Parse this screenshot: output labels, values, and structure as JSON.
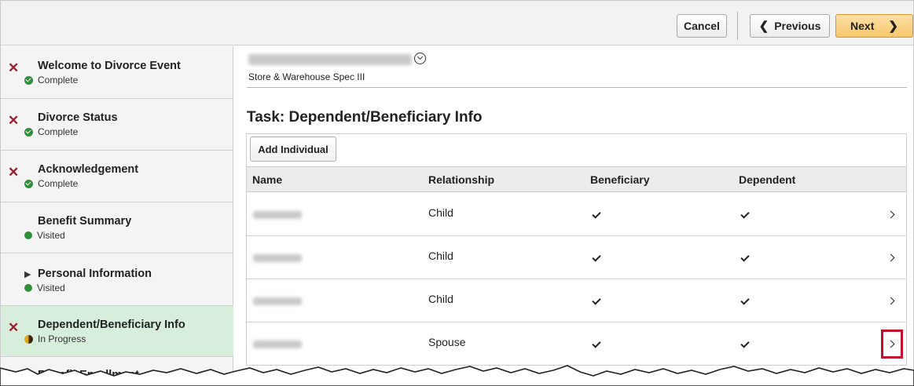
{
  "toolbar": {
    "cancel_label": "Cancel",
    "previous_label": "Previous",
    "next_label": "Next",
    "previous_icon": "chevron-left-icon",
    "next_icon": "chevron-right-icon"
  },
  "sidebar": {
    "items": [
      {
        "label": "Welcome to Divorce Event",
        "status": "Complete",
        "required": true,
        "status_icon": "check-circle-icon"
      },
      {
        "label": "Divorce Status",
        "status": "Complete",
        "required": true,
        "status_icon": "check-circle-icon"
      },
      {
        "label": "Acknowledgement",
        "status": "Complete",
        "required": true,
        "status_icon": "check-circle-icon"
      },
      {
        "label": "Benefit Summary",
        "status": "Visited",
        "required": false,
        "status_icon": "green-dot-icon"
      },
      {
        "label": "Personal Information",
        "status": "Visited",
        "required": false,
        "status_icon": "green-dot-icon",
        "expandable": true
      },
      {
        "label": "Dependent/Beneficiary Info",
        "status": "In Progress",
        "required": true,
        "status_icon": "half-circle-icon",
        "active": true
      },
      {
        "label": "Benefit Enrollment"
      }
    ]
  },
  "employee": {
    "job_title": "Store & Warehouse Spec III",
    "expand_icon": "chevron-down-circle-icon"
  },
  "main": {
    "task_title": "Task: Dependent/Beneficiary Info",
    "add_button_label": "Add Individual",
    "columns": [
      "Name",
      "Relationship",
      "Beneficiary",
      "Dependent"
    ],
    "rows": [
      {
        "relationship": "Child",
        "beneficiary": true,
        "dependent": true
      },
      {
        "relationship": "Child",
        "beneficiary": true,
        "dependent": true
      },
      {
        "relationship": "Child",
        "beneficiary": true,
        "dependent": true
      },
      {
        "relationship": "Spouse",
        "beneficiary": true,
        "dependent": true
      }
    ]
  },
  "colors": {
    "required_star": "#9b1f2e",
    "active_row": "#d7eedd",
    "next_button": "#f7c76c",
    "highlight_box": "#c0102e"
  }
}
